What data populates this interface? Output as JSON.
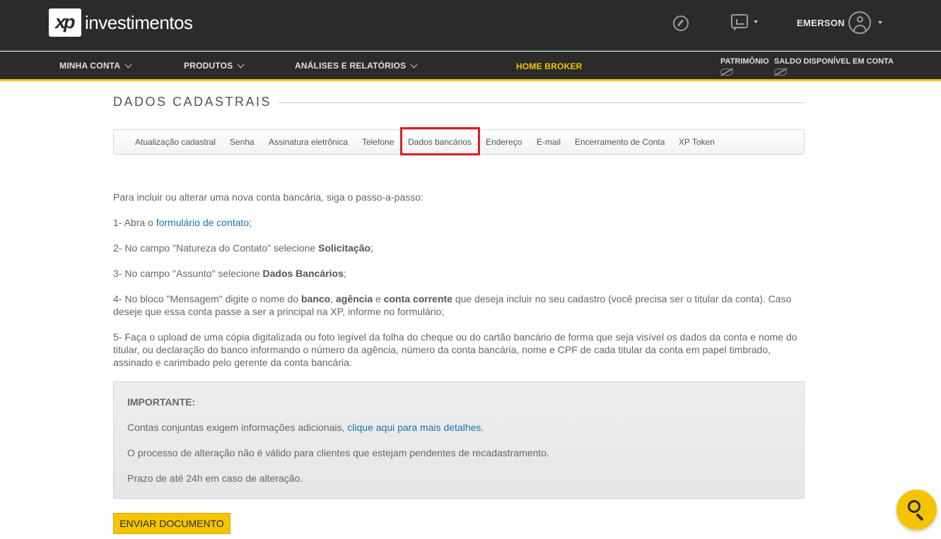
{
  "header": {
    "logo_mark": "xp",
    "logo_text": "investimentos",
    "user_name": "EMERSON"
  },
  "nav": {
    "items": [
      {
        "label": "MINHA CONTA"
      },
      {
        "label": "PRODUTOS"
      },
      {
        "label": "ANÁLISES E RELATÓRIOS"
      }
    ],
    "home_broker": "HOME BROKER",
    "patrimonio": "PATRIMÔNIO",
    "saldo": "SALDO DISPONÍVEL EM CONTA"
  },
  "page": {
    "title": "DADOS CADASTRAIS"
  },
  "tabs": [
    {
      "label": "Atualização cadastral"
    },
    {
      "label": "Senha"
    },
    {
      "label": "Assinatura eletrônica"
    },
    {
      "label": "Telefone"
    },
    {
      "label": "Dados bancários",
      "active": true
    },
    {
      "label": "Endereço"
    },
    {
      "label": "E-mail"
    },
    {
      "label": "Encerramento de Conta"
    },
    {
      "label": "XP Token"
    }
  ],
  "content": {
    "intro": "Para incluir ou alterar uma nova conta bancária, siga o passo-a-passo:",
    "step1_prefix": "1- Abra o ",
    "step1_link": "formulário de contato",
    "step1_suffix": ";",
    "step2_prefix": "2- No campo \"Natureza do Contato\" selecione ",
    "step2_bold": "Solicitação",
    "step2_suffix": ";",
    "step3_prefix": "3- No campo \"Assunto\" selecione ",
    "step3_bold": "Dados Bancários",
    "step3_suffix": ";",
    "step4_a": "4- No bloco \"Mensagem\" digite o nome do ",
    "step4_b1": "banco",
    "step4_c": ", ",
    "step4_b2": "agência",
    "step4_d": " e ",
    "step4_b3": "conta corrente",
    "step4_e": " que deseja incluir no seu cadastro (você precisa ser o titular da conta). Caso deseje que essa conta passe a ser a principal na XP, informe no formulário;",
    "step5": "5- Faça o upload de uma cópia digitalizada ou foto legível da folha do cheque ou do cartão bancário de forma que seja visível os dados da conta e nome do titular, ou declaração do banco informando o número da agência, número da conta bancária, nome e CPF de cada titular da conta em papel timbrado, assinado e carimbado pelo gerente da conta bancária."
  },
  "notice": {
    "heading": "IMPORTANTE:",
    "line1_prefix": "Contas conjuntas exigem informações adicionais, ",
    "line1_link": "clique aqui para mais detalhes",
    "line1_suffix": ".",
    "line2": "O processo de alteração não é válido para clientes que estejam pendentes de recadastramento.",
    "line3": "Prazo de até 24h em caso de alteração."
  },
  "actions": {
    "send_document": "ENVIAR DOCUMENTO"
  },
  "colors": {
    "brand_yellow": "#f5c400",
    "header_bg": "#2b2b2b",
    "link_blue": "#1a73b5",
    "highlight_red": "#e01b24"
  },
  "icons": [
    "compass-icon",
    "chat-icon",
    "avatar-icon",
    "eye-hidden-icon",
    "search-icon"
  ]
}
